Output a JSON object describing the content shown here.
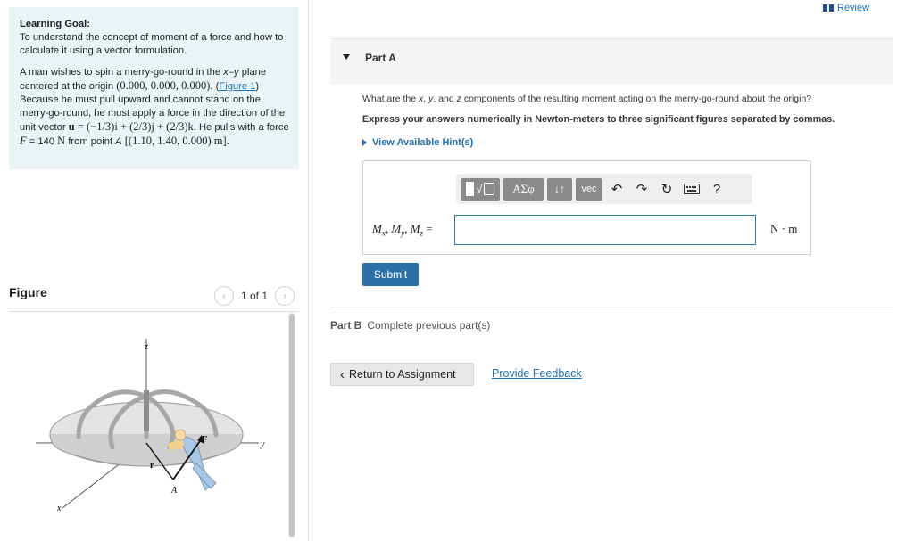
{
  "left": {
    "learning_goal_heading": "Learning Goal:",
    "learning_goal_text": "To understand the concept of moment of a force and how to calculate it using a vector formulation.",
    "problem": {
      "t1": "A man wishes to spin a merry-go-round in the ",
      "xy": "x",
      "t1b": "–",
      "xy2": "y",
      "t2": " plane centered at the origin ",
      "origin": "(0.000, 0.000, 0.000)",
      "t3": ". (",
      "figure_link": "Figure 1",
      "t4": ") Because he must pull upward and cannot stand on the merry-go-round, he must apply a force in the direction of the unit vector ",
      "u": "u",
      "uvec": " = (−1/3)i + (2/3)j + (2/3)k",
      "t5": ". He pulls with a force ",
      "F": "F",
      "t6": " = 140 ",
      "N": "N",
      "t7": " from point ",
      "A": "A",
      "coords": "[(1.10, 1.40, 0.000) m]."
    },
    "figure_title": "Figure",
    "pager_text": "1 of 1",
    "figure_labels": {
      "z": "z",
      "y": "y",
      "x": "x",
      "F": "F",
      "r": "r",
      "A": "A"
    }
  },
  "right": {
    "review_label": "Review",
    "part_a_title": "Part A",
    "question_pre": "What are the ",
    "q_x": "x",
    "q_sep1": ", ",
    "q_y": "y",
    "q_sep2": ", and ",
    "q_z": "z",
    "question_post": " components of the resulting moment acting on the merry-go-round about the origin?",
    "instruction": "Express your answers numerically in Newton-meters to three significant figures separated by commas.",
    "hint_label": "View Available Hint(s)",
    "toolbar": {
      "greek": "ΑΣφ",
      "arrows": "↓↑",
      "vec": "vec",
      "help": "?"
    },
    "var_label": "Mx, My, Mz =",
    "answer_value": "",
    "unit": "N · m",
    "submit_label": "Submit",
    "part_b_title": "Part B",
    "part_b_status": "Complete previous part(s)",
    "return_label": "Return to Assignment",
    "feedback_label": "Provide Feedback"
  }
}
